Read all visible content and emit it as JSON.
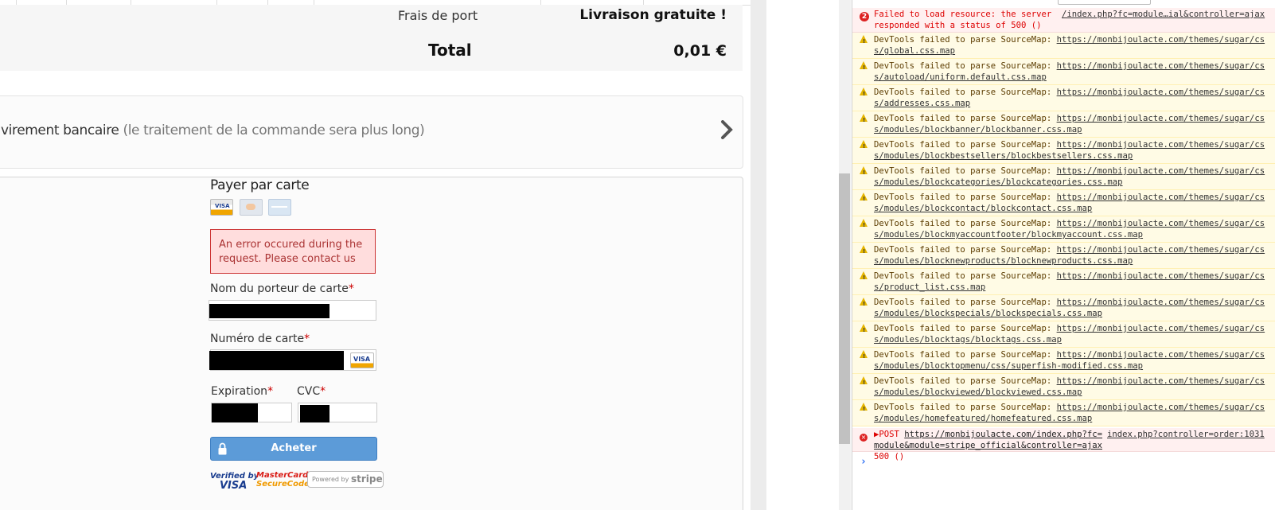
{
  "order_summary": {
    "shipping_label": "Frais de port",
    "shipping_value": "Livraison gratuite !",
    "total_label": "Total",
    "total_value": "0,01 €"
  },
  "bank_transfer": {
    "title": "virement bancaire",
    "note": "(le traitement de la commande sera plus long)"
  },
  "card_payment": {
    "title": "Payer par carte",
    "accepted_cards": [
      "visa-card-icon",
      "mastercard-card-icon",
      "amex-card-icon"
    ],
    "visa_text": "VISA",
    "error_message": "An error occured during the request. Please contact us",
    "fields": {
      "cardholder_label": "Nom du porteur de carte",
      "number_label": "Numéro de carte",
      "expiry_label": "Expiration",
      "cvc_label": "CVC",
      "required_mark": "*"
    },
    "buy_button": "Acheter",
    "trust": {
      "verified_a": "Verified by",
      "verified_b": "VISA",
      "mastercard_a": "MasterCard.",
      "mastercard_b": "SecureCode.",
      "powered": "Powered by",
      "stripe": "stripe"
    }
  },
  "devtools": {
    "error_count": "2",
    "error_load": {
      "text": "Failed to load resource: the server responded with a status of 500 ()",
      "link": "/index.php?fc=module…ial&controller=ajax"
    },
    "warning_prefix": "DevTools failed to parse SourceMap: ",
    "sourcemaps": [
      "https://monbijoulacte.com/themes/sugar/css/global.css.map",
      "https://monbijoulacte.com/themes/sugar/css/autoload/uniform.default.css.map",
      "https://monbijoulacte.com/themes/sugar/css/addresses.css.map",
      "https://monbijoulacte.com/themes/sugar/css/modules/blockbanner/blockbanner.css.map",
      "https://monbijoulacte.com/themes/sugar/css/modules/blockbestsellers/blockbestsellers.css.map",
      "https://monbijoulacte.com/themes/sugar/css/modules/blockcategories/blockcategories.css.map",
      "https://monbijoulacte.com/themes/sugar/css/modules/blockcontact/blockcontact.css.map",
      "https://monbijoulacte.com/themes/sugar/css/modules/blockmyaccountfooter/blockmyaccount.css.map",
      "https://monbijoulacte.com/themes/sugar/css/modules/blocknewproducts/blocknewproducts.css.map",
      "https://monbijoulacte.com/themes/sugar/css/product_list.css.map",
      "https://monbijoulacte.com/themes/sugar/css/modules/blockspecials/blockspecials.css.map",
      "https://monbijoulacte.com/themes/sugar/css/modules/blocktags/blocktags.css.map",
      "https://monbijoulacte.com/themes/sugar/css/modules/blocktopmenu/css/superfish-modified.css.map",
      "https://monbijoulacte.com/themes/sugar/css/modules/blockviewed/blockviewed.css.map",
      "https://monbijoulacte.com/themes/sugar/css/modules/homefeatured/homefeatured.css.map"
    ],
    "post_error": {
      "method": "POST",
      "url": "https://monbijoulacte.com/index.php?fc=module&module=stripe_official&controller=ajax",
      "status": "500 ()",
      "source": "index.php?controller=order:1031"
    },
    "prompt": "›"
  }
}
